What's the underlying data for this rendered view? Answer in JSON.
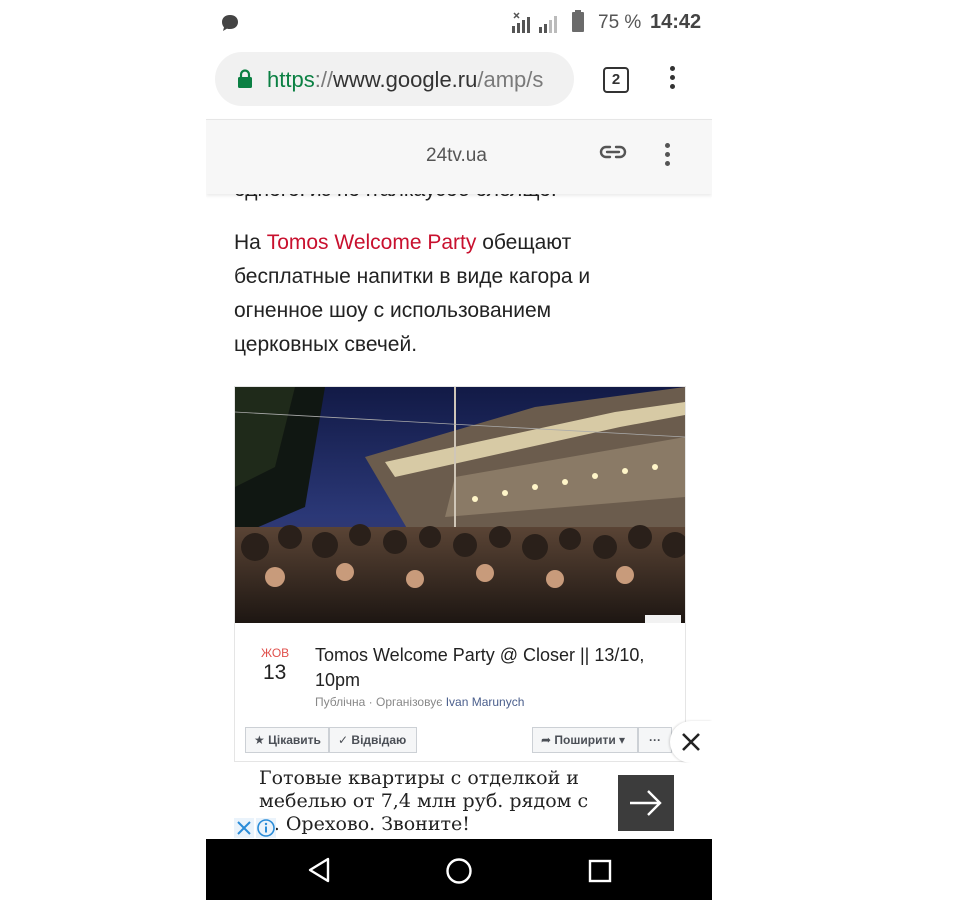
{
  "status_bar": {
    "battery_percent": "75 %",
    "time": "14:42"
  },
  "browser": {
    "url": {
      "scheme": "https",
      "separator": "://",
      "host": "www.google.ru",
      "path": "/amp/s"
    },
    "tab_count": "2"
  },
  "amp_header": {
    "domain": "24tv.ua"
  },
  "article": {
    "cut_line": "одногоГиз почталкаусоб олелщо.",
    "para_prefix": "На ",
    "para_link": "Tomos Welcome Party",
    "para_rest": " обещают бесплатные напитки в виде кагора и огненное шоу с использованием церковных свечей."
  },
  "event_card": {
    "month": "ЖОВ",
    "day": "13",
    "title": "Tomos Welcome Party @ Closer || 13/10, 10pm",
    "visibility": "Публічна · Організовує ",
    "organizer": "Ivan Marunych",
    "buttons": {
      "interested": "Цікавить",
      "going": "Відвідаю",
      "share": "Поширити",
      "more": "···"
    }
  },
  "ad": {
    "text": "Готовые квартиры с отделкой и мебелью от 7,4 млн руб. рядом с м. Орехово. Звоните!"
  },
  "colors": {
    "link_red": "#c8102e",
    "lock_green": "#0b8043",
    "ad_button": "#3c3c3c",
    "nav_bar": "#000000"
  }
}
